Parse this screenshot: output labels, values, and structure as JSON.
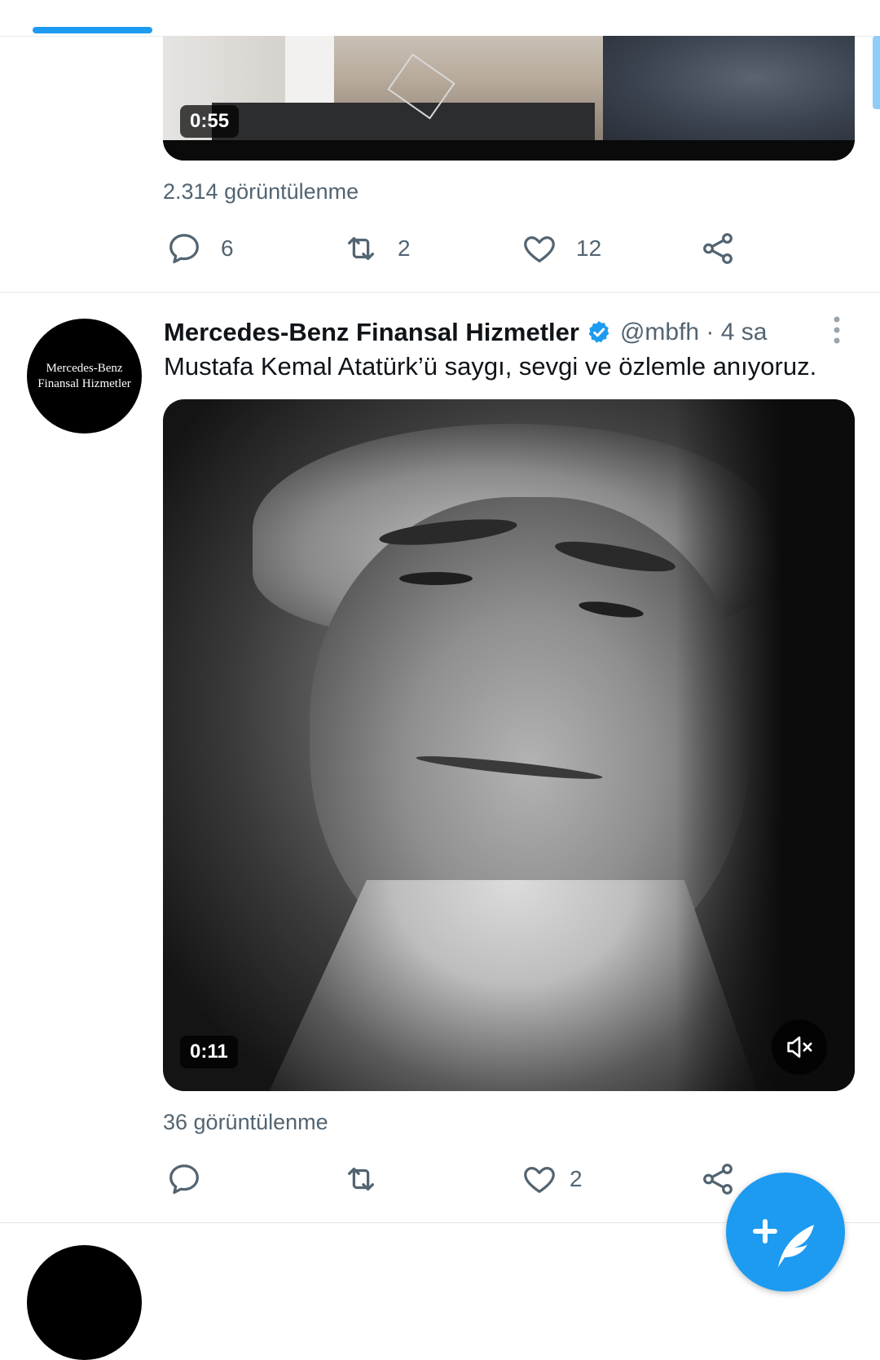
{
  "tweet_previous": {
    "video_duration": "0:55",
    "views": "2.314 görüntülenme",
    "actions": {
      "reply_count": "6",
      "retweet_count": "2",
      "like_count": "12"
    }
  },
  "tweet": {
    "avatar_text_line1": "Mercedes-Benz",
    "avatar_text_line2": "Finansal Hizmetler",
    "display_name": "Mercedes-Benz Finansal Hizmetler",
    "handle_time": "@mbfh · 4 sa",
    "text": "Mustafa Kemal Atatürk’ü saygı, sevgi ve özlemle anıyoruz.",
    "video_duration": "0:11",
    "views": "36 görüntülenme",
    "actions": {
      "reply_count": "",
      "retweet_count": "",
      "like_count": "2"
    }
  },
  "colors": {
    "accent": "#1d9bf0",
    "secondary_text": "#536471",
    "primary_text": "#0f1419"
  },
  "icons": [
    "reply-icon",
    "retweet-icon",
    "like-icon",
    "share-icon",
    "verified-badge-icon",
    "more-icon",
    "mute-icon",
    "compose-icon"
  ]
}
